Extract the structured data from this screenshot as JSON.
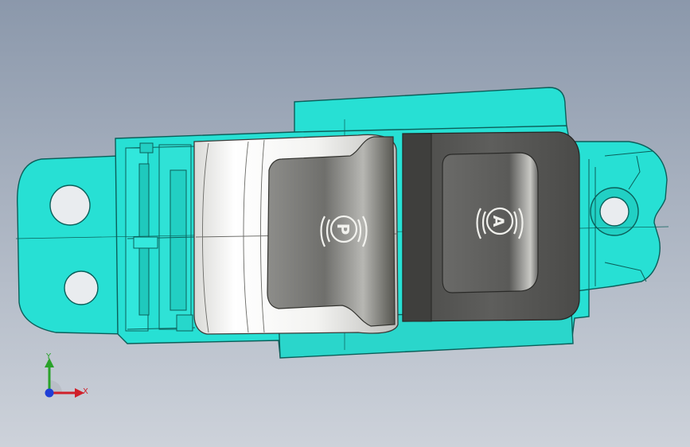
{
  "viewport": {
    "background_top": "#8b98ab",
    "background_bottom": "#cdd2da"
  },
  "model": {
    "housing_color": "#27e0d4",
    "housing_edge": "#0b5f5a",
    "p_button": {
      "symbol": "P",
      "body_color": "#f4f4f2",
      "cap_color": "#6c6c6a"
    },
    "a_button": {
      "symbol": "A",
      "cap_color": "#5b5b59"
    }
  },
  "triad": {
    "x_label": "X",
    "y_label": "Y",
    "x_color": "#d0202a",
    "y_color": "#2aa22a",
    "z_color": "#1f3fd6"
  }
}
